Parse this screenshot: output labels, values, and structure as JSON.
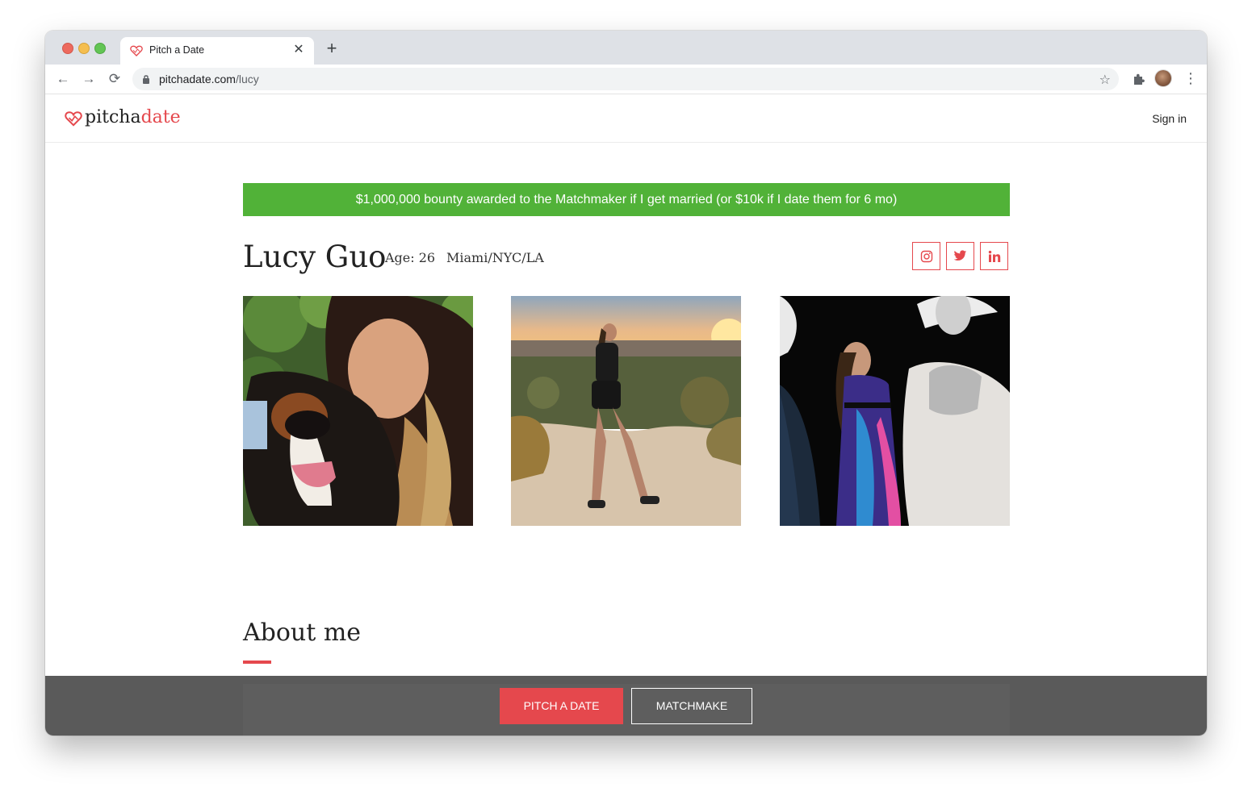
{
  "browser": {
    "tab_title": "Pitch a Date",
    "url_host": "pitchadate.com",
    "url_path": "/lucy"
  },
  "site": {
    "logo_main": "pitcha",
    "logo_accent": "date",
    "signin_label": "Sign in",
    "accent_color": "#e5484d"
  },
  "profile": {
    "bounty_text": "$1,000,000 bounty awarded to the Matchmaker if I get married (or $10k if I date them for 6 mo)",
    "bounty_color": "#51b238",
    "name": "Lucy Guo",
    "age": "Age: 26",
    "location": "Miami/NYC/LA",
    "social_icons": [
      "instagram-icon",
      "twitter-icon",
      "linkedin-icon"
    ]
  },
  "about": {
    "heading": "About me"
  },
  "actions": {
    "pitch_label": "PITCH A DATE",
    "matchmake_label": "MATCHMAKE"
  }
}
